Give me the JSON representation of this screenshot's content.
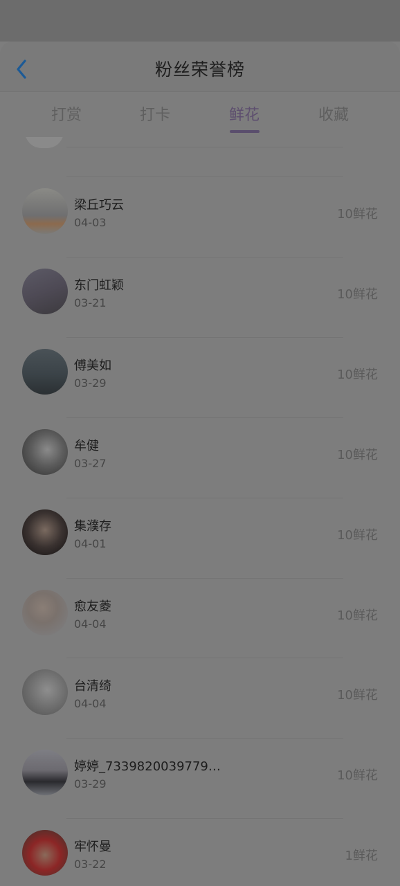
{
  "header": {
    "title": "粉丝荣誉榜",
    "back_icon": "chevron-left-icon",
    "accent": "#1c6fbf"
  },
  "tabs": [
    {
      "label": "打赏",
      "active": false
    },
    {
      "label": "打卡",
      "active": false
    },
    {
      "label": "鲜花",
      "active": true
    },
    {
      "label": "收藏",
      "active": false
    }
  ],
  "fans": [
    {
      "name": "梁丘巧云",
      "date": "04-03",
      "amount": "10鲜花"
    },
    {
      "name": "东门虹颖",
      "date": "03-21",
      "amount": "10鲜花"
    },
    {
      "name": "傅美如",
      "date": "03-29",
      "amount": "10鲜花"
    },
    {
      "name": "牟健",
      "date": "03-27",
      "amount": "10鲜花"
    },
    {
      "name": "集濮存",
      "date": "04-01",
      "amount": "10鲜花"
    },
    {
      "name": "愈友菱",
      "date": "04-04",
      "amount": "10鲜花"
    },
    {
      "name": "台清绮",
      "date": "04-04",
      "amount": "10鲜花"
    },
    {
      "name": "婷婷_73398200397799...",
      "date": "03-29",
      "amount": "10鲜花"
    },
    {
      "name": "牢怀曼",
      "date": "03-22",
      "amount": "1鲜花"
    }
  ]
}
